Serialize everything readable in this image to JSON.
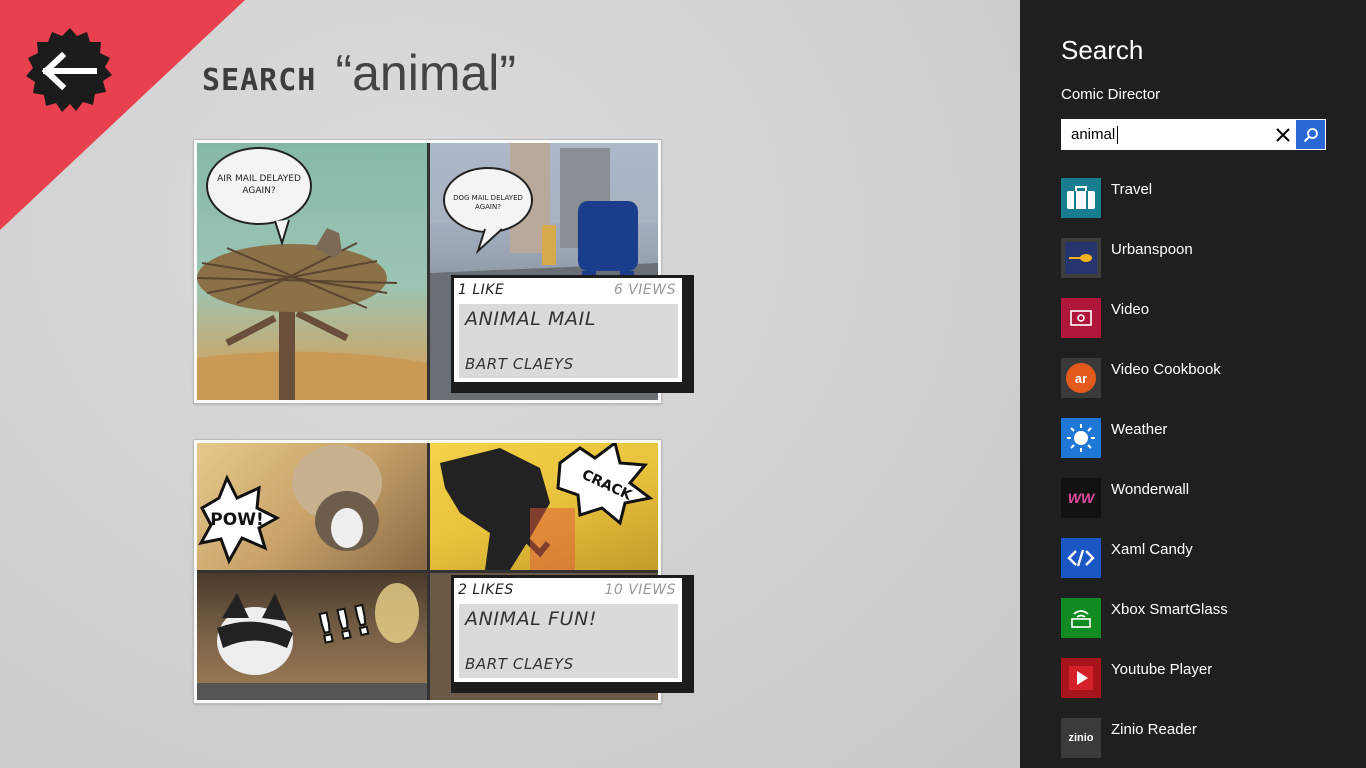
{
  "page": {
    "title_keyword": "SEARCH",
    "title_query": "“animal”"
  },
  "results": [
    {
      "likes": "1 LIKE",
      "views": "6 VIEWS",
      "title": "ANIMAL MAIL",
      "author": "BART CLAEYS",
      "bubbles": [
        "AIR MAIL DELAYED AGAIN?",
        "DOG MAIL DELAYED AGAIN?"
      ]
    },
    {
      "likes": "2 LIKES",
      "views": "10 VIEWS",
      "title": "ANIMAL FUN!",
      "author": "BART CLAEYS",
      "sfx": [
        "POW!",
        "CRACK",
        "!!!"
      ]
    }
  ],
  "search_pane": {
    "title": "Search",
    "scope": "Comic Director",
    "query": "animal",
    "apps": [
      {
        "name": "Travel",
        "icon": "suitcase-icon",
        "color": "#177d8f"
      },
      {
        "name": "Urbanspoon",
        "icon": "spoon-icon",
        "color": "#3d3d3d"
      },
      {
        "name": "Video",
        "icon": "video-icon",
        "color": "#b0153c"
      },
      {
        "name": "Video Cookbook",
        "icon": "cookbook-icon",
        "color": "#3a3a3a"
      },
      {
        "name": "Weather",
        "icon": "sun-icon",
        "color": "#1f78d8"
      },
      {
        "name": "Wonderwall",
        "icon": "wonderwall-icon",
        "color": "#111111"
      },
      {
        "name": "Xaml Candy",
        "icon": "candy-icon",
        "color": "#1a56c4"
      },
      {
        "name": "Xbox SmartGlass",
        "icon": "smartglass-icon",
        "color": "#128a22"
      },
      {
        "name": "Youtube Player",
        "icon": "play-icon",
        "color": "#a8141c"
      },
      {
        "name": "Zinio Reader",
        "icon": "zinio-icon",
        "color": "#3b3b3b"
      }
    ],
    "icon_texts": {
      "video_cookbook": "ar",
      "wonderwall": "WW",
      "zinio": "zinio"
    }
  }
}
